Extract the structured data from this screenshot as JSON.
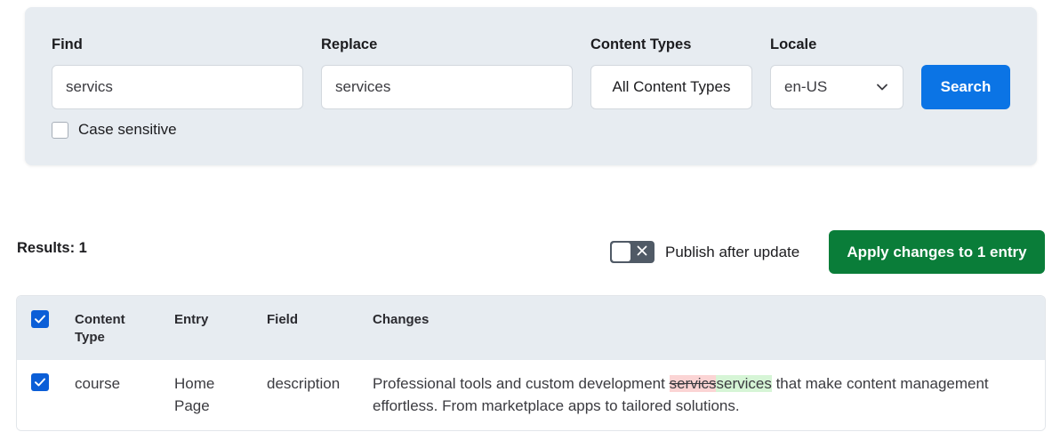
{
  "search": {
    "find_label": "Find",
    "find_value": "servics",
    "replace_label": "Replace",
    "replace_value": "services",
    "content_types_label": "Content Types",
    "content_types_value": "All Content Types",
    "locale_label": "Locale",
    "locale_value": "en-US",
    "search_button": "Search",
    "case_sensitive_label": "Case sensitive",
    "case_sensitive_checked": false
  },
  "results": {
    "count_text": "Results: 1",
    "publish_label": "Publish after update",
    "publish_enabled": false,
    "apply_button": "Apply changes to 1 entry"
  },
  "table": {
    "headers": {
      "content_type": "Content Type",
      "entry": "Entry",
      "field": "Field",
      "changes": "Changes"
    },
    "rows": [
      {
        "checked": true,
        "content_type": "course",
        "entry": "Home Page",
        "field": "description",
        "change_before": "Professional tools and custom development ",
        "change_removed": "servics",
        "change_added": "services",
        "change_after": " that make content management effortless. From marketplace apps to tailored solutions."
      }
    ]
  },
  "colors": {
    "search_button": "#0b74e5",
    "apply_button": "#0a7d39",
    "checkbox": "#0b5ed7",
    "removed_highlight": "#fbd4d4",
    "added_highlight": "#d6f5d6"
  }
}
